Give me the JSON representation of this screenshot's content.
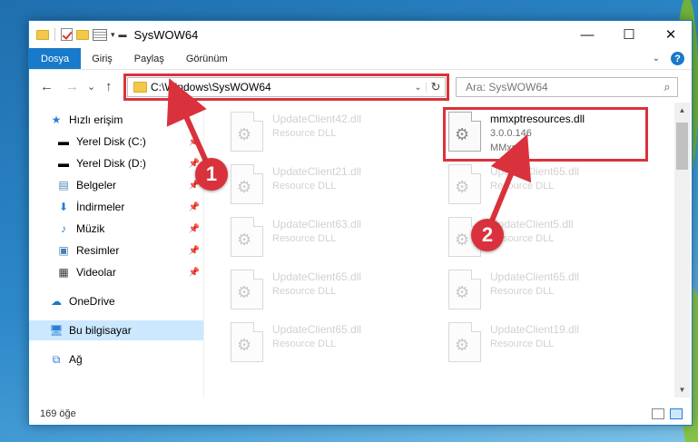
{
  "window": {
    "title": "SysWOW64"
  },
  "titlebar": {
    "minimize": "—",
    "maximize": "☐",
    "close": "✕"
  },
  "ribbon": {
    "tabs": [
      {
        "label": "Dosya",
        "active": true
      },
      {
        "label": "Giriş"
      },
      {
        "label": "Paylaş"
      },
      {
        "label": "Görünüm"
      }
    ],
    "help": "?"
  },
  "nav": {
    "back": "←",
    "forward": "→",
    "recent": "⌄",
    "up": "↑",
    "address": "C:\\Windows\\SysWOW64",
    "search_placeholder": "Ara: SysWOW64"
  },
  "sidebar": {
    "items": [
      {
        "label": "Hızlı erişim",
        "icon": "star-icon"
      },
      {
        "label": "Yerel Disk (C:)",
        "icon": "drive-icon",
        "pinned": true
      },
      {
        "label": "Yerel Disk (D:)",
        "icon": "drive-icon",
        "pinned": true
      },
      {
        "label": "Belgeler",
        "icon": "documents-icon",
        "pinned": true
      },
      {
        "label": "İndirmeler",
        "icon": "download-icon",
        "pinned": true
      },
      {
        "label": "Müzik",
        "icon": "music-icon",
        "pinned": true
      },
      {
        "label": "Resimler",
        "icon": "pictures-icon",
        "pinned": true
      },
      {
        "label": "Videolar",
        "icon": "video-icon",
        "pinned": true
      },
      {
        "label": "OneDrive",
        "icon": "cloud-icon"
      },
      {
        "label": "Bu bilgisayar",
        "icon": "computer-icon",
        "active": true
      },
      {
        "label": "Ağ",
        "icon": "network-icon"
      }
    ]
  },
  "files": {
    "left_column": [
      {
        "name": "UpdateClient42.dll",
        "type": "Resource DLL"
      },
      {
        "name": "UpdateClient21.dll",
        "type": "Resource DLL"
      },
      {
        "name": "UpdateClient63.dll",
        "type": "Resource DLL"
      },
      {
        "name": "UpdateClient65.dll",
        "type": "Resource DLL"
      },
      {
        "name": "UpdateClient65.dll",
        "type": "Resource DLL"
      }
    ],
    "highlighted": {
      "name": "mmxptresources.dll",
      "version": "3.0.0.146",
      "type": "MMxpt"
    },
    "right_column": [
      {
        "name": "UpdateClient65.dll",
        "type": "Resource DLL"
      },
      {
        "name": "UpdateClient5.dll",
        "type": "Resource DLL"
      },
      {
        "name": "UpdateClient65.dll",
        "type": "Resource DLL"
      },
      {
        "name": "UpdateClient19.dll",
        "type": "Resource DLL"
      }
    ]
  },
  "status": {
    "item_count": "169 öğe"
  },
  "callouts": {
    "one": "1",
    "two": "2"
  },
  "colors": {
    "accent": "#1979ca",
    "highlight": "#d9323c",
    "selected": "#cce8ff"
  }
}
